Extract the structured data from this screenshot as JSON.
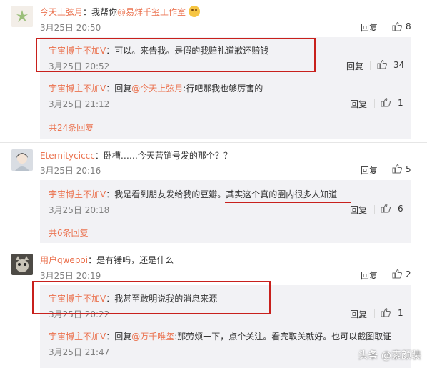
{
  "actions": {
    "reply": "回复",
    "total_replies_label_prefix": "共",
    "total_replies_label_suffix": "条回复"
  },
  "comments": [
    {
      "user": "今天上弦月",
      "text_prefix": "：我帮你",
      "mention": "@易烊千玺工作室",
      "emoji": "smile-emoji",
      "time": "3月25日 20:50",
      "likes": "8",
      "replies": [
        {
          "user": "宇宙博主不加V",
          "text": "：可以。来告我。是假的我赔礼道歉还赔钱",
          "time": "3月25日 20:52",
          "likes": "34",
          "highlight": true
        },
        {
          "user": "宇宙博主不加V",
          "text_prefix": "：回复",
          "mention": "@今天上弦月",
          "text": ":行吧那我也够厉害的",
          "time": "3月25日 21:12",
          "likes": "1"
        }
      ],
      "more": "共24条回复"
    },
    {
      "user": "Eternityciccc",
      "text": "：卧槽……今天营销号发的那个？？",
      "time": "3月25日 20:16",
      "likes": "5",
      "replies": [
        {
          "user": "宇宙博主不加V",
          "text": "：我是看到朋友发给我的豆瓣。其实这个真的圈内很多人知道",
          "time": "3月25日 20:18",
          "likes": "6",
          "underline": true
        }
      ],
      "more": "共6条回复"
    },
    {
      "user": "用户qwepoi",
      "text": "：是有锤吗，还是什么",
      "time": "3月25日 20:19",
      "likes": "2",
      "replies": [
        {
          "user": "宇宙博主不加V",
          "text": "：我甚至敢明说我的消息来源",
          "time": "3月25日 20:22",
          "likes": "1",
          "highlight": true
        },
        {
          "user": "宇宙博主不加V",
          "text_prefix": "：回复",
          "mention": "@万千唯玺",
          "text": ":那劳烦一下，点个关注。看完取关就好。也可以截图取证",
          "time": "3月25日 21:47",
          "likes": ""
        }
      ]
    }
  ],
  "watermark": "头条 @素颜装",
  "colors": {
    "name": "#eb7350",
    "highlight_border": "#c8201c",
    "reply_bg": "#f2f2f5"
  }
}
